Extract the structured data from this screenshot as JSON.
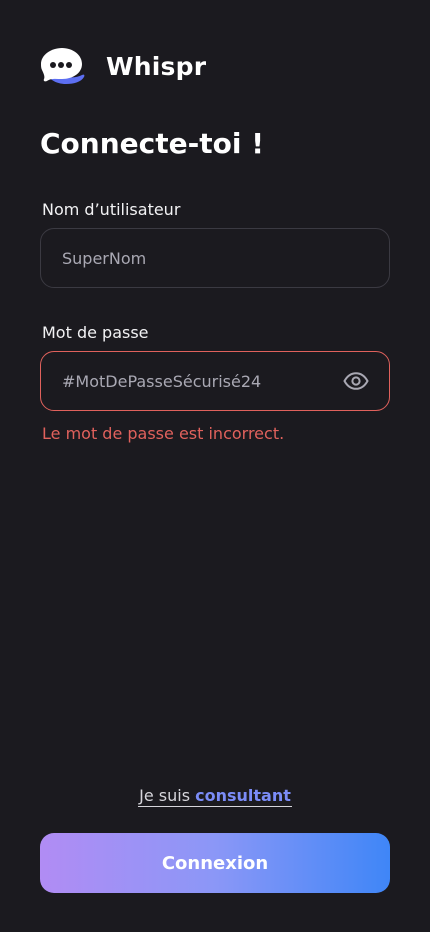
{
  "app": {
    "name": "Whispr",
    "logo_icon": "chat-bubble-logo-icon"
  },
  "title": "Connecte-toi !",
  "username": {
    "label": "Nom d’utilisateur",
    "value": "SuperNom"
  },
  "password": {
    "label": "Mot de passe",
    "value": "#MotDePasseSécurisé24",
    "toggle_icon": "eye-icon",
    "error": "Le mot de passe est incorrect."
  },
  "consultant": {
    "prefix": "Je suis ",
    "link": "consultant"
  },
  "submit_label": "Connexion",
  "colors": {
    "background": "#1b1a1f",
    "error": "#e0615c",
    "accent": "#7b8cf7",
    "button_gradient_start": "#b18cf4",
    "button_gradient_end": "#3f86f7"
  }
}
